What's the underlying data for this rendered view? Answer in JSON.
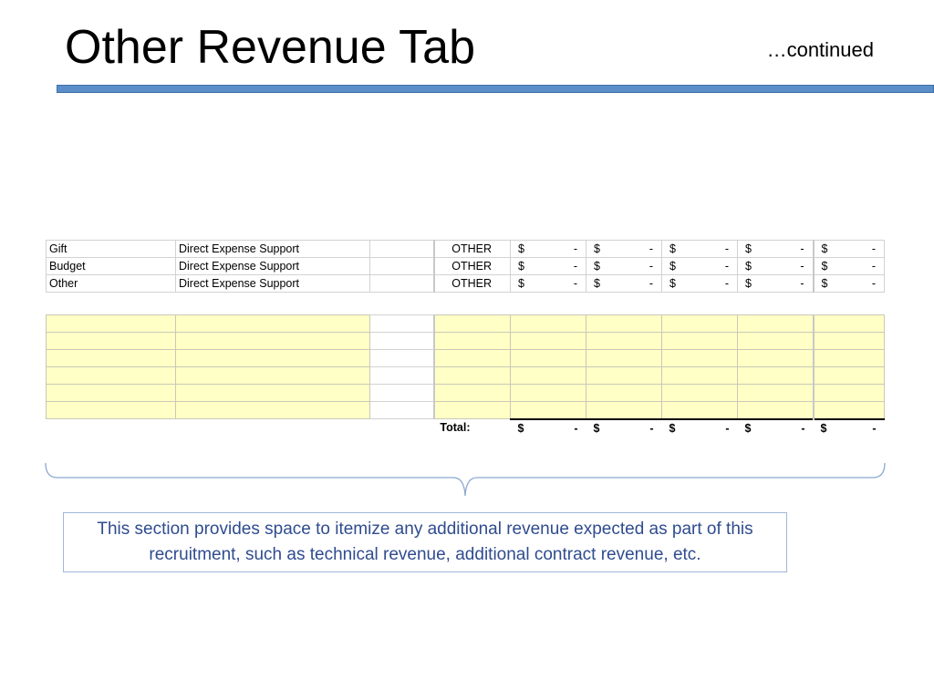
{
  "slide": {
    "title": "Other Revenue Tab",
    "continued": "…continued",
    "accent_color": "#5b8ec8"
  },
  "revenue_rows": [
    {
      "source": "Gift",
      "description": "Direct Expense Support",
      "type": "OTHER",
      "amounts": [
        {
          "cur": "$",
          "val": "-"
        },
        {
          "cur": "$",
          "val": "-"
        },
        {
          "cur": "$",
          "val": "-"
        },
        {
          "cur": "$",
          "val": "-"
        },
        {
          "cur": "$",
          "val": "-"
        }
      ]
    },
    {
      "source": "Budget",
      "description": "Direct Expense Support",
      "type": "OTHER",
      "amounts": [
        {
          "cur": "$",
          "val": "-"
        },
        {
          "cur": "$",
          "val": "-"
        },
        {
          "cur": "$",
          "val": "-"
        },
        {
          "cur": "$",
          "val": "-"
        },
        {
          "cur": "$",
          "val": "-"
        }
      ]
    },
    {
      "source": "Other",
      "description": "Direct Expense Support",
      "type": "OTHER",
      "amounts": [
        {
          "cur": "$",
          "val": "-"
        },
        {
          "cur": "$",
          "val": "-"
        },
        {
          "cur": "$",
          "val": "-"
        },
        {
          "cur": "$",
          "val": "-"
        },
        {
          "cur": "$",
          "val": "-"
        }
      ]
    }
  ],
  "input_area": {
    "highlight_color": "#ffffc6"
  },
  "total": {
    "label": "Total:",
    "amounts": [
      {
        "cur": "$",
        "val": "-"
      },
      {
        "cur": "$",
        "val": "-"
      },
      {
        "cur": "$",
        "val": "-"
      },
      {
        "cur": "$",
        "val": "-"
      },
      {
        "cur": "$",
        "val": "-"
      }
    ]
  },
  "note": {
    "text": "This section provides space to itemize any additional revenue expected as part of this recruitment, such as technical revenue, additional contract revenue, etc."
  }
}
